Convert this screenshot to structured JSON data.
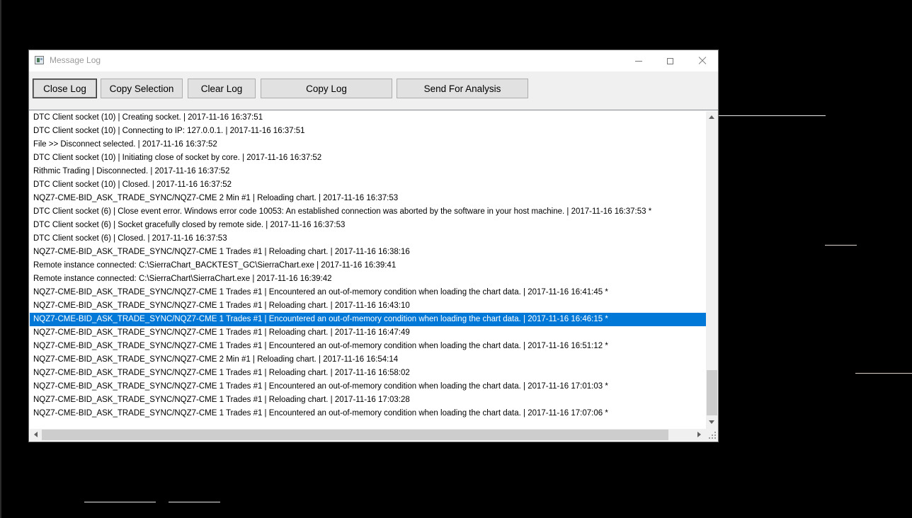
{
  "window": {
    "title": "Message Log"
  },
  "toolbar": {
    "close_log": "Close Log",
    "copy_selection": "Copy Selection",
    "clear_log": "Clear Log",
    "copy_log": "Copy Log",
    "send_for_analysis": "Send For Analysis"
  },
  "log": {
    "selected_index": 15,
    "selection_color": "#0078d7",
    "entries": [
      "DTC Client socket (10) | Creating socket. | 2017-11-16  16:37:51",
      "DTC Client socket (10) | Connecting to IP: 127.0.0.1. | 2017-11-16  16:37:51",
      "File >> Disconnect selected. | 2017-11-16  16:37:52",
      "DTC Client socket (10) | Initiating close of socket by core. | 2017-11-16  16:37:52",
      "Rithmic Trading | Disconnected. | 2017-11-16  16:37:52",
      "DTC Client socket (10) | Closed. | 2017-11-16  16:37:52",
      "NQZ7-CME-BID_ASK_TRADE_SYNC/NQZ7-CME  2 Min   #1 | Reloading chart. | 2017-11-16  16:37:53",
      "DTC Client socket (6) | Close event error. Windows error code 10053: An established connection was aborted by the software in your host machine. | 2017-11-16  16:37:53 *",
      "DTC Client socket (6) | Socket gracefully closed by remote side. | 2017-11-16  16:37:53",
      "DTC Client socket (6) | Closed. | 2017-11-16  16:37:53",
      "NQZ7-CME-BID_ASK_TRADE_SYNC/NQZ7-CME  1 Trades  #1 | Reloading chart. | 2017-11-16  16:38:16",
      "Remote instance connected: C:\\SierraChart_BACKTEST_GC\\SierraChart.exe | 2017-11-16  16:39:41",
      "Remote instance connected: C:\\SierraChart\\SierraChart.exe | 2017-11-16  16:39:42",
      "NQZ7-CME-BID_ASK_TRADE_SYNC/NQZ7-CME  1 Trades  #1 | Encountered an out-of-memory condition when loading the chart data. | 2017-11-16  16:41:45 *",
      "NQZ7-CME-BID_ASK_TRADE_SYNC/NQZ7-CME  1 Trades  #1 | Reloading chart. | 2017-11-16  16:43:10",
      "NQZ7-CME-BID_ASK_TRADE_SYNC/NQZ7-CME  1 Trades  #1 | Encountered an out-of-memory condition when loading the chart data. | 2017-11-16  16:46:15 *",
      "NQZ7-CME-BID_ASK_TRADE_SYNC/NQZ7-CME  1 Trades  #1 | Reloading chart. | 2017-11-16  16:47:49",
      "NQZ7-CME-BID_ASK_TRADE_SYNC/NQZ7-CME  1 Trades  #1 | Encountered an out-of-memory condition when loading the chart data. | 2017-11-16  16:51:12 *",
      "NQZ7-CME-BID_ASK_TRADE_SYNC/NQZ7-CME  2 Min   #1 | Reloading chart. | 2017-11-16  16:54:14",
      "NQZ7-CME-BID_ASK_TRADE_SYNC/NQZ7-CME  1 Trades  #1 | Reloading chart. | 2017-11-16  16:58:02",
      "NQZ7-CME-BID_ASK_TRADE_SYNC/NQZ7-CME  1 Trades  #1 | Encountered an out-of-memory condition when loading the chart data. | 2017-11-16  17:01:03 *",
      "NQZ7-CME-BID_ASK_TRADE_SYNC/NQZ7-CME  1 Trades  #1 | Reloading chart. | 2017-11-16  17:03:28",
      "NQZ7-CME-BID_ASK_TRADE_SYNC/NQZ7-CME  1 Trades  #1 | Encountered an out-of-memory condition when loading the chart data. | 2017-11-16  17:07:06 *"
    ]
  }
}
